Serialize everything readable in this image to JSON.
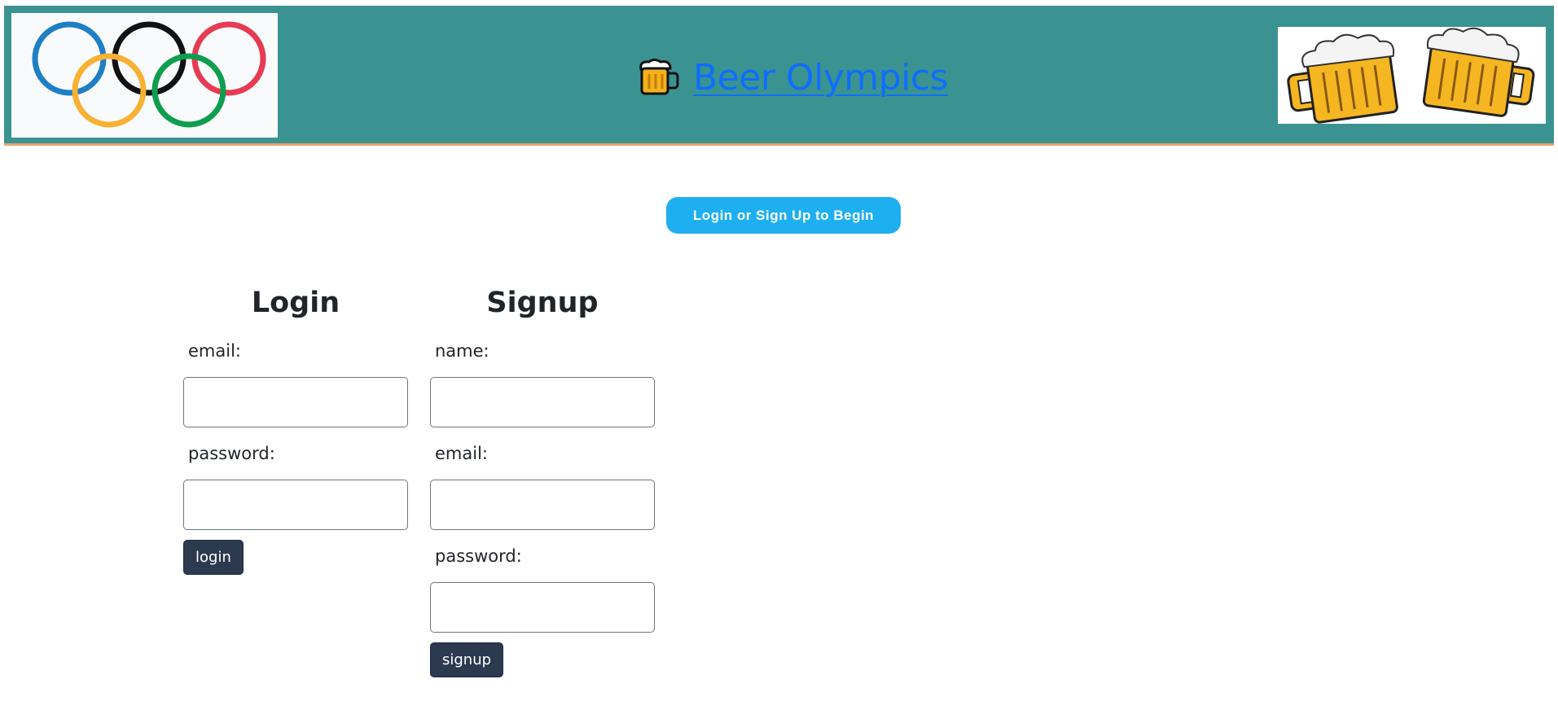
{
  "header": {
    "title": "Beer Olympics",
    "left_logo_icon": "olympic-rings-icon",
    "title_icon": "beer-mugs-emoji-icon",
    "right_image_icon": "clinking-beer-mugs-icon",
    "colors": {
      "background": "#3a9391",
      "border": "#e9a36e",
      "link": "#0d6efd"
    }
  },
  "begin_button": {
    "label": "Login or Sign Up to Begin",
    "color": "#1eaff0"
  },
  "login": {
    "heading": "Login",
    "email_label": "email:",
    "email_value": "",
    "password_label": "password:",
    "password_value": "",
    "button_label": "login"
  },
  "signup": {
    "heading": "Signup",
    "name_label": "name:",
    "name_value": "",
    "email_label": "email:",
    "email_value": "",
    "password_label": "password:",
    "password_value": "",
    "button_label": "signup"
  },
  "button_color": "#2c3a4f"
}
